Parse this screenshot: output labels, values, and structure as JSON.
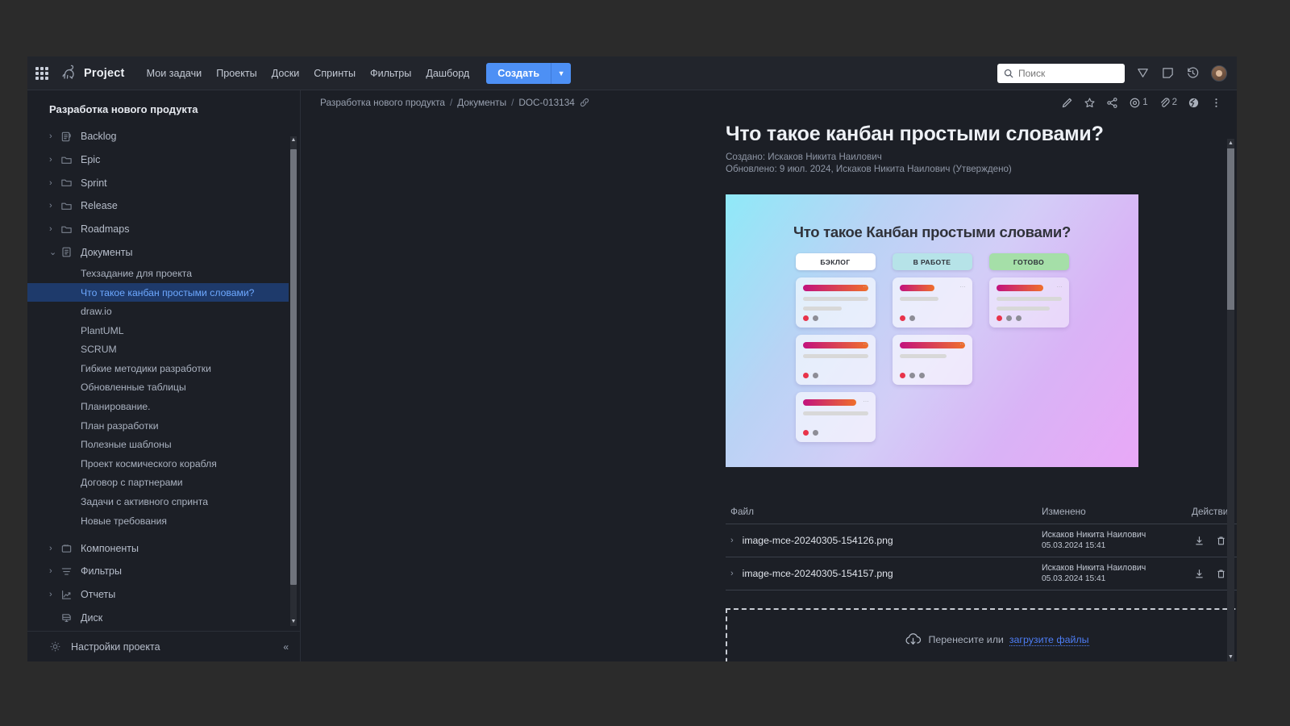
{
  "topbar": {
    "brand": "Project",
    "logo_icon": "dinosaur-logo-icon",
    "apps_icon": "apps-grid-icon",
    "nav": [
      {
        "label": "Мои задачи"
      },
      {
        "label": "Проекты"
      },
      {
        "label": "Доски"
      },
      {
        "label": "Спринты"
      },
      {
        "label": "Фильтры"
      },
      {
        "label": "Дашборд"
      }
    ],
    "create_label": "Создать",
    "create_caret_icon": "chevron-down-icon",
    "search": {
      "placeholder": "Поиск",
      "value": "",
      "icon": "search-icon"
    },
    "icons": [
      {
        "name": "tag-icon"
      },
      {
        "name": "notes-icon"
      },
      {
        "name": "history-icon"
      }
    ],
    "avatar": "user-avatar",
    "accent_color": "#4d90f5"
  },
  "sidebar": {
    "project_title": "Разработка нового продукта",
    "tree": [
      {
        "label": "Backlog",
        "icon": "backlog-icon",
        "chevron": "›",
        "type": "node"
      },
      {
        "label": "Epic",
        "icon": "folder-icon",
        "chevron": "›",
        "type": "node"
      },
      {
        "label": "Sprint",
        "icon": "folder-icon",
        "chevron": "›",
        "type": "node"
      },
      {
        "label": "Release",
        "icon": "folder-icon",
        "chevron": "›",
        "type": "node"
      },
      {
        "label": "Roadmaps",
        "icon": "folder-icon",
        "chevron": "›",
        "type": "node"
      },
      {
        "label": "Документы",
        "icon": "document-icon",
        "chevron": "⌄",
        "type": "node"
      },
      {
        "label": "Техзадание для проекта",
        "type": "doc"
      },
      {
        "label": "Что такое канбан простыми словами?",
        "type": "doc",
        "active": true
      },
      {
        "label": "draw.io",
        "type": "doc"
      },
      {
        "label": "PlantUML",
        "type": "doc"
      },
      {
        "label": "SCRUM",
        "type": "doc"
      },
      {
        "label": "Гибкие методики разработки",
        "type": "doc"
      },
      {
        "label": "Обновленные таблицы",
        "type": "doc"
      },
      {
        "label": "Планирование.",
        "type": "doc"
      },
      {
        "label": "План разработки",
        "type": "doc"
      },
      {
        "label": "Полезные шаблоны",
        "type": "doc"
      },
      {
        "label": "Проект космического корабля",
        "type": "doc"
      },
      {
        "label": "Договор с партнерами",
        "type": "doc"
      },
      {
        "label": "Задачи с активного спринта",
        "type": "doc"
      },
      {
        "label": "Новые требования",
        "type": "doc"
      },
      {
        "label": "Компоненты",
        "icon": "components-icon",
        "chevron": "›",
        "type": "node"
      },
      {
        "label": "Фильтры",
        "icon": "filter-icon",
        "chevron": "›",
        "type": "node"
      },
      {
        "label": "Отчеты",
        "icon": "chart-icon",
        "chevron": "›",
        "type": "node"
      },
      {
        "label": "Диск",
        "icon": "disk-icon",
        "chevron": "",
        "type": "node"
      }
    ],
    "settings": {
      "label": "Настройки проекта",
      "icon": "gear-icon"
    },
    "collapse_label": "«"
  },
  "breadcrumb": {
    "items": [
      "Разработка нового продукта",
      "Документы",
      "DOC-013134"
    ],
    "separator": "/",
    "link_icon": "link-icon"
  },
  "page_actions": [
    {
      "name": "edit-icon",
      "count": ""
    },
    {
      "name": "star-icon",
      "count": ""
    },
    {
      "name": "share-icon",
      "count": ""
    },
    {
      "name": "watch-eye-icon",
      "count": "1"
    },
    {
      "name": "attachment-paperclip-icon",
      "count": "2"
    },
    {
      "name": "globe-icon",
      "count": ""
    },
    {
      "name": "more-vertical-icon",
      "count": ""
    }
  ],
  "document": {
    "title": "Что такое канбан простыми словами?",
    "created_line": "Создано: Искаков Никита Наилович",
    "updated_line": "Обновлено: 9 июл. 2024, Искаков Никита Наилович  (Утверждено)"
  },
  "kanban_image": {
    "title": "Что такое Канбан простыми словами?",
    "columns": [
      {
        "header": "БЭКЛОГ",
        "header_color": "#ffffff",
        "cards": [
          {
            "lines": 2,
            "dots": [
              "#e8334a",
              "#8d8d96"
            ]
          },
          {
            "lines": 1,
            "dots": [
              "#e8334a",
              "#8d8d96"
            ]
          },
          {
            "lines": 1,
            "dots": [
              "#e8334a",
              "#8d8d96"
            ]
          }
        ]
      },
      {
        "header": "В РАБОТЕ",
        "header_color": "#b6e3e8",
        "cards": [
          {
            "lines": 1,
            "dots": [
              "#e8334a",
              "#8d8d96"
            ]
          },
          {
            "lines": 1,
            "dots": [
              "#e8334a",
              "#8d8d96",
              "#8d8d96"
            ]
          }
        ]
      },
      {
        "header": "ГОТОВО",
        "header_color": "#a5dfa8",
        "cards": [
          {
            "lines": 2,
            "dots": [
              "#e8334a",
              "#8d8d96",
              "#8d8d96"
            ]
          }
        ]
      }
    ]
  },
  "files": {
    "columns": {
      "file": "Файл",
      "modified": "Изменено",
      "actions": "Действия"
    },
    "rows": [
      {
        "name": "image-mce-20240305-154126.png",
        "author": "Искаков Никита Наилович",
        "date": "05.03.2024 15:41",
        "chevron": "›",
        "actions": [
          "download-icon",
          "trash-icon"
        ]
      },
      {
        "name": "image-mce-20240305-154157.png",
        "author": "Искаков Никита Наилович",
        "date": "05.03.2024 15:41",
        "chevron": "›",
        "actions": [
          "download-icon",
          "trash-icon"
        ]
      }
    ]
  },
  "dropzone": {
    "icon": "cloud-upload-icon",
    "text": "Перенесите или",
    "link": "загрузите файлы"
  }
}
